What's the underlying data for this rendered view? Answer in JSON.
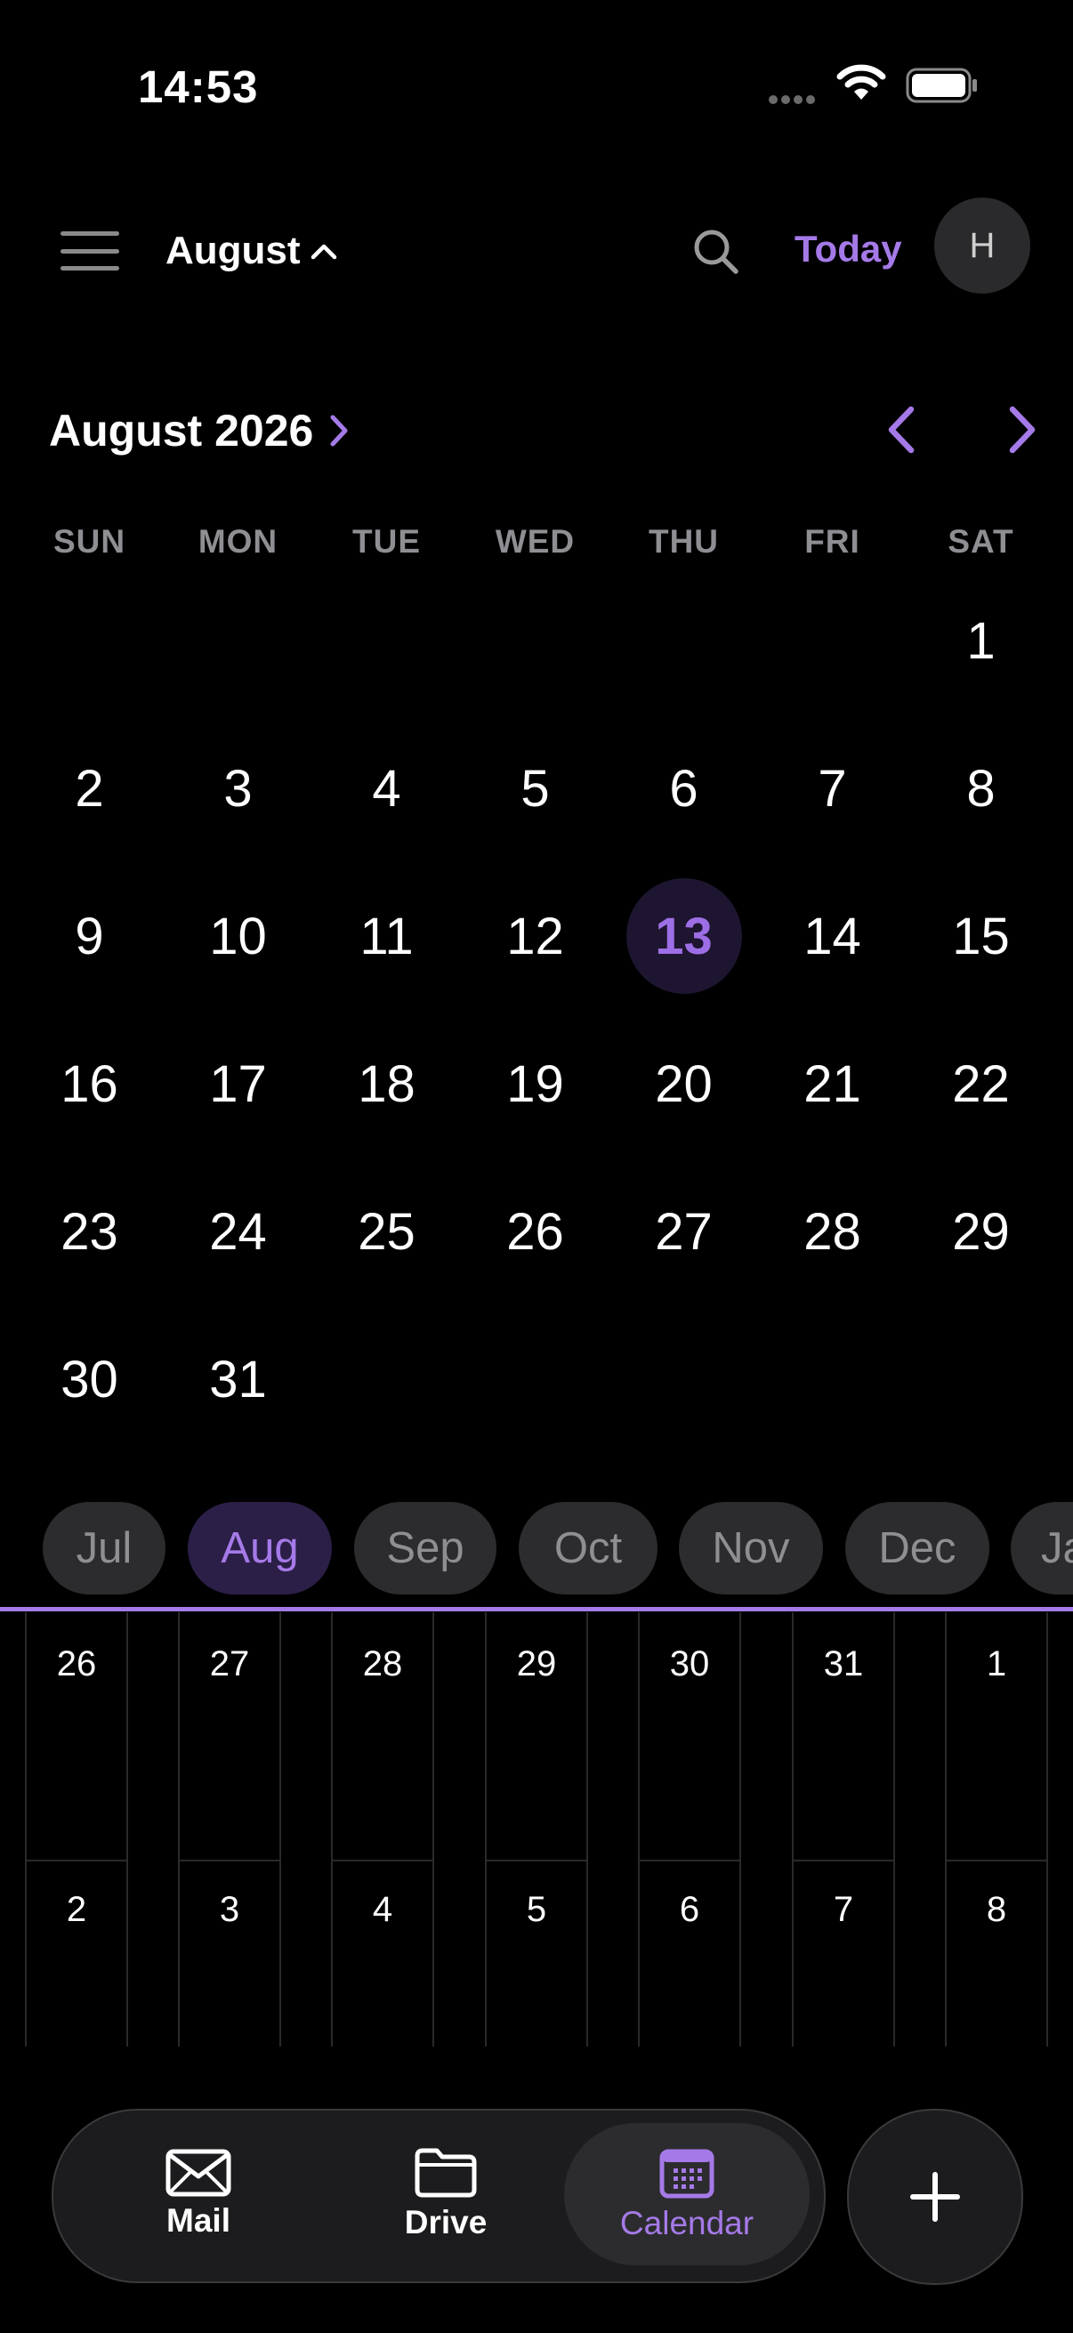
{
  "status_bar": {
    "time": "14:53"
  },
  "header": {
    "month_label": "August",
    "today_label": "Today",
    "avatar_initial": "H",
    "accent_color": "#a57ae8"
  },
  "calendar": {
    "title": "August 2026",
    "weekdays": [
      "SUN",
      "MON",
      "TUE",
      "WED",
      "THU",
      "FRI",
      "SAT"
    ],
    "weeks": [
      [
        "",
        "",
        "",
        "",
        "",
        "",
        "1"
      ],
      [
        "2",
        "3",
        "4",
        "5",
        "6",
        "7",
        "8"
      ],
      [
        "9",
        "10",
        "11",
        "12",
        "13",
        "14",
        "15"
      ],
      [
        "16",
        "17",
        "18",
        "19",
        "20",
        "21",
        "22"
      ],
      [
        "23",
        "24",
        "25",
        "26",
        "27",
        "28",
        "29"
      ],
      [
        "30",
        "31",
        "",
        "",
        "",
        "",
        ""
      ]
    ],
    "selected_day": "13"
  },
  "month_chips": {
    "items": [
      "Jul",
      "Aug",
      "Sep",
      "Oct",
      "Nov",
      "Dec",
      "Jan"
    ],
    "active": "Aug"
  },
  "mini_grid": {
    "rows": [
      [
        "26",
        "27",
        "28",
        "29",
        "30",
        "31",
        "1"
      ],
      [
        "2",
        "3",
        "4",
        "5",
        "6",
        "7",
        "8"
      ]
    ]
  },
  "tab_bar": {
    "tabs": [
      {
        "label": "Mail",
        "icon": "mail-icon"
      },
      {
        "label": "Drive",
        "icon": "folder-icon"
      },
      {
        "label": "Calendar",
        "icon": "calendar-icon"
      }
    ],
    "active": "Calendar"
  },
  "fab": {
    "icon": "plus-icon"
  }
}
